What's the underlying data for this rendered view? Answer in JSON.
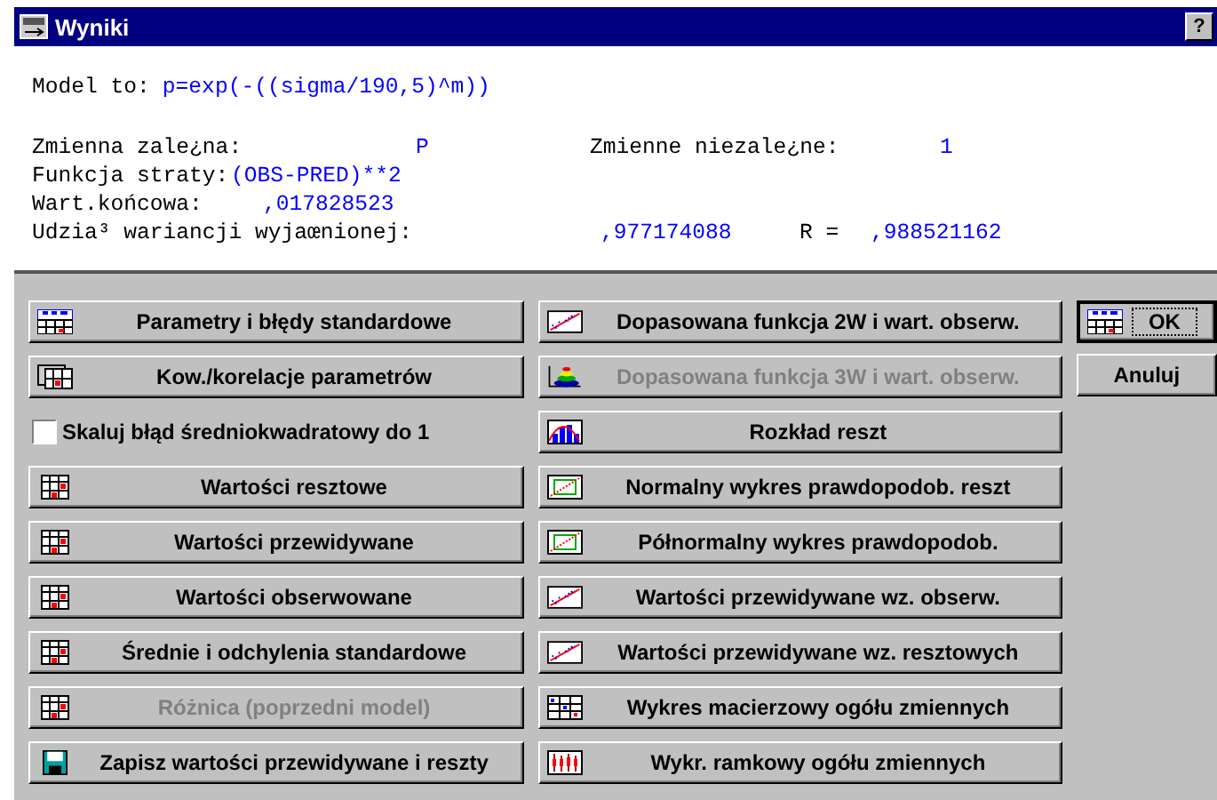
{
  "window": {
    "title": "Wyniki",
    "help_button": "?"
  },
  "model": {
    "label": "Model to:",
    "value": "p=exp(-((sigma/190,5)^m))"
  },
  "stats": [
    {
      "cells": [
        {
          "kind": "label",
          "text": "Zmienna zale¿na:"
        },
        {
          "kind": "value",
          "text": "P"
        },
        {
          "kind": "label",
          "text": "Zmienne niezale¿ne:"
        },
        {
          "kind": "value",
          "text": "1"
        }
      ]
    },
    {
      "cells": [
        {
          "kind": "label",
          "text": "Funkcja straty:"
        },
        {
          "kind": "value",
          "text": "(OBS-PRED)**2"
        }
      ]
    },
    {
      "cells": [
        {
          "kind": "label",
          "text": "Wart.końcowa:"
        },
        {
          "kind": "value",
          "text": ",017828523"
        }
      ]
    },
    {
      "cells": [
        {
          "kind": "label",
          "text": "Udzia³ wariancji wyjaœnionej:"
        },
        {
          "kind": "value",
          "text": ",977174088"
        },
        {
          "kind": "label",
          "text": "R ="
        },
        {
          "kind": "value",
          "text": ",988521162"
        }
      ]
    }
  ],
  "left_buttons": [
    {
      "kind": "button",
      "label": "Parametry i błędy standardowe",
      "disabled": false
    },
    {
      "kind": "button",
      "label": "Kow./korelacje parametrów",
      "disabled": false
    },
    {
      "kind": "checkbox",
      "label": "Skaluj błąd średniokwadratowy do 1",
      "checked": false
    },
    {
      "kind": "button",
      "label": "Wartości resztowe",
      "disabled": false
    },
    {
      "kind": "button",
      "label": "Wartości przewidywane",
      "disabled": false
    },
    {
      "kind": "button",
      "label": "Wartości obserwowane",
      "disabled": false
    },
    {
      "kind": "button",
      "label": "Średnie i odchylenia standardowe",
      "disabled": false
    },
    {
      "kind": "button",
      "label": "Różnica (poprzedni model)",
      "disabled": true
    },
    {
      "kind": "button",
      "label": "Zapisz wartości przewidywane i reszty",
      "disabled": false
    }
  ],
  "right_buttons": [
    {
      "label": "Dopasowana funkcja 2W i wart. obserw.",
      "disabled": false
    },
    {
      "label": "Dopasowana funkcja 3W i wart. obserw.",
      "disabled": true
    },
    {
      "label": "Rozkład reszt",
      "disabled": false
    },
    {
      "label": "Normalny wykres prawdopodob. reszt",
      "disabled": false
    },
    {
      "label": "Półnormalny wykres prawdopodob.",
      "disabled": false
    },
    {
      "label": "Wartości przewidywane wz. obserw.",
      "disabled": false
    },
    {
      "label": "Wartości przewidywane wz. resztowych",
      "disabled": false
    },
    {
      "label": "Wykres macierzowy ogółu zmiennych",
      "disabled": false
    },
    {
      "label": "Wykr. ramkowy  ogółu zmiennych",
      "disabled": false
    }
  ],
  "dialog_buttons": [
    {
      "label": "OK",
      "default": true
    },
    {
      "label": "Anuluj",
      "default": false
    }
  ]
}
